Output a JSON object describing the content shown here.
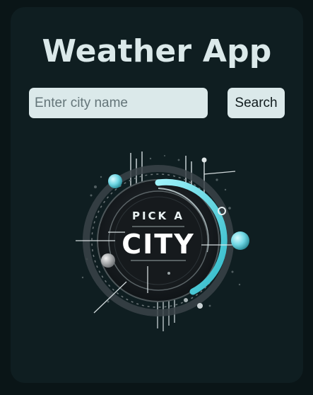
{
  "app": {
    "title": "Weather App"
  },
  "search": {
    "placeholder": "Enter city name",
    "value": "",
    "button_label": "Search"
  },
  "emblem": {
    "line1": "PICK A",
    "line2": "CITY"
  },
  "colors": {
    "page_bg": "#0a1517",
    "card_bg": "#0f1e21",
    "text": "#dbe9ea",
    "field_bg": "#dbe9ea",
    "accent": "#4fd3df"
  },
  "icons": [
    "pick-a-city-emblem"
  ]
}
